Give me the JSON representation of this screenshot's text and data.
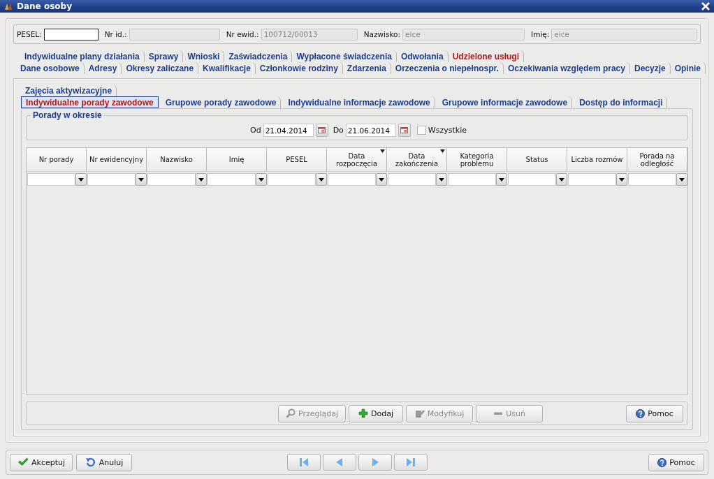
{
  "window": {
    "title": "Dane osoby"
  },
  "header_fields": [
    {
      "label": "PESEL:",
      "disabled": false
    },
    {
      "label": "Nr id.:",
      "disabled": true
    },
    {
      "label": "Nr ewid.:",
      "value": "100712/00013",
      "disabled": true
    },
    {
      "label": "Nazwisko:",
      "value": "eice",
      "disabled": true
    },
    {
      "label": "Imię:",
      "value": "eice",
      "disabled": true
    }
  ],
  "tab_rows": [
    [
      {
        "label": "Indywidualne plany działania",
        "selected": false
      },
      {
        "label": "Sprawy",
        "selected": false
      },
      {
        "label": "Wnioski",
        "selected": false
      },
      {
        "label": "Zaświadczenia",
        "selected": false
      },
      {
        "label": "Wypłacone świadczenia",
        "selected": false
      },
      {
        "label": "Odwołania",
        "selected": false
      },
      {
        "label": "Udzielone usługi",
        "selected": true
      }
    ],
    [
      {
        "label": "Dane osobowe",
        "selected": false
      },
      {
        "label": "Adresy",
        "selected": false
      },
      {
        "label": "Okresy zaliczane",
        "selected": false
      },
      {
        "label": "Kwalifikacje",
        "selected": false
      },
      {
        "label": "Członkowie rodziny",
        "selected": false
      },
      {
        "label": "Zdarzenia",
        "selected": false
      },
      {
        "label": "Orzeczenia o niepełnospr.",
        "selected": false
      },
      {
        "label": "Oczekiwania względem pracy",
        "selected": false
      },
      {
        "label": "Decyzje",
        "selected": false
      },
      {
        "label": "Opinie",
        "selected": false
      }
    ]
  ],
  "subtab_rows": [
    [
      {
        "label": "Zajęcia aktywizacyjne",
        "selected": false
      }
    ],
    [
      {
        "label": "Indywidualne porady zawodowe",
        "selected": true
      },
      {
        "label": "Grupowe porady zawodowe",
        "selected": false
      },
      {
        "label": "Indywidualne informacje zawodowe",
        "selected": false
      },
      {
        "label": "Grupowe informacje zawodowe",
        "selected": false
      },
      {
        "label": "Dostęp do informacji",
        "selected": false
      }
    ]
  ],
  "period": {
    "title": "Porady w okresie",
    "from_label": "Od",
    "from": "21.04.2014",
    "to_label": "Do",
    "to": "21.06.2014",
    "all_label": "Wszystkie",
    "all_checked": false
  },
  "table": {
    "columns": [
      {
        "label": "Nr porady",
        "sorted": false
      },
      {
        "label": "Nr ewidencyjny",
        "sorted": false
      },
      {
        "label": "Nazwisko",
        "sorted": false
      },
      {
        "label": "Imię",
        "sorted": false
      },
      {
        "label": "PESEL",
        "sorted": false
      },
      {
        "label": "Data rozpoczęcia",
        "sorted": true
      },
      {
        "label": "Data zakończenia",
        "sorted": true
      },
      {
        "label": "Kategoria problemu",
        "sorted": false
      },
      {
        "label": "Status",
        "sorted": false
      },
      {
        "label": "Liczba rozmów",
        "sorted": false
      },
      {
        "label": "Porada na odległość",
        "sorted": false
      }
    ]
  },
  "actions": [
    {
      "kind": "view",
      "label": "Przeglądaj",
      "disabled": true
    },
    {
      "kind": "add",
      "label": "Dodaj",
      "disabled": false
    },
    {
      "kind": "edit",
      "label": "Modyfikuj",
      "disabled": true
    },
    {
      "kind": "remove",
      "label": "Usuń",
      "disabled": true
    }
  ],
  "help_button": {
    "label": "Pomoc"
  },
  "footer": {
    "left": [
      {
        "kind": "accept",
        "label": "Akceptuj"
      },
      {
        "kind": "cancel",
        "label": "Anuluj"
      }
    ],
    "nav": [
      {
        "kind": "first",
        "disabled": true
      },
      {
        "kind": "prev",
        "disabled": true
      },
      {
        "kind": "next",
        "disabled": true
      },
      {
        "kind": "last",
        "disabled": true
      }
    ],
    "help": {
      "label": "Pomoc"
    }
  }
}
